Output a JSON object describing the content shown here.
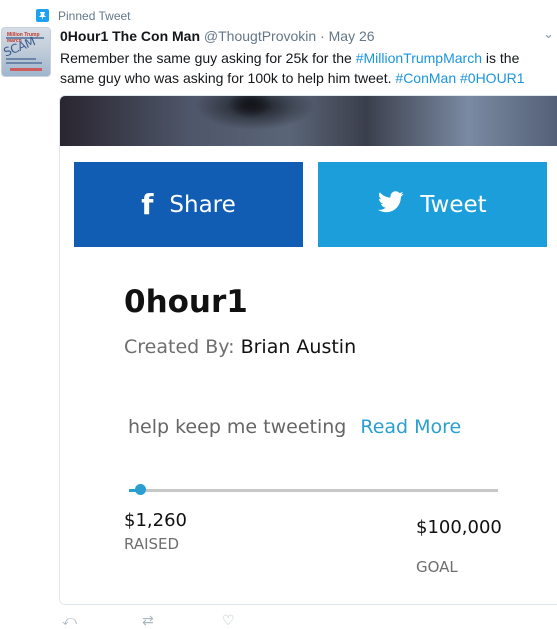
{
  "pinned": {
    "label": "Pinned Tweet",
    "icon": "pin-icon"
  },
  "tweet": {
    "display_name": "0Hour1 The Con Man",
    "handle": "@ThougtProvokin",
    "separator": " · ",
    "date": "May 26",
    "text_1": "Remember the same guy asking for 25k for the ",
    "link_1": "#MillionTrumpMarch",
    "text_2": " is the same guy who was asking for 100k to help him tweet. ",
    "link_2": "#ConMan",
    "text_3": " ",
    "link_3": "#0HOUR1",
    "avatar_text": "SCAM",
    "avatar_top_text": "Million Trump March"
  },
  "card": {
    "share_label": "Share",
    "tweet_label": "Tweet",
    "campaign_title": "0hour1",
    "created_by_label": "Created By:",
    "creator_name": " Brian Austin",
    "description": "help keep me tweeting",
    "read_more": "Read More",
    "raised_amount": "$1,260",
    "raised_label": "RAISED",
    "goal_amount": "$100,000",
    "goal_label": "GOAL",
    "progress_fraction": 0.0126,
    "colors": {
      "facebook": "#115db3",
      "twitter": "#1b9ed9",
      "accent": "#2a9fd0"
    }
  }
}
